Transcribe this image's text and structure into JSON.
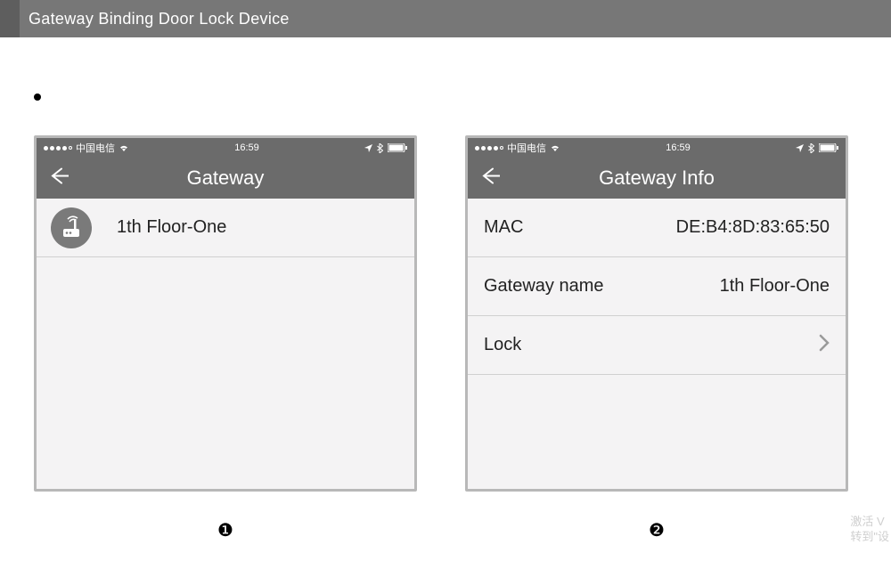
{
  "banner": {
    "title": "Gateway Binding Door Lock Device"
  },
  "status": {
    "carrier": "中国电信",
    "time": "16:59"
  },
  "phone1": {
    "navTitle": "Gateway",
    "item": {
      "label": "1th Floor-One"
    }
  },
  "phone2": {
    "navTitle": "Gateway Info",
    "rows": {
      "macLabel": "MAC",
      "macValue": "DE:B4:8D:83:65:50",
      "gatewayNameLabel": "Gateway name",
      "gatewayNameValue": "1th Floor-One",
      "lockLabel": "Lock"
    }
  },
  "steps": {
    "one": "❶",
    "two": "❷"
  },
  "watermark": {
    "line1": "激活 V",
    "line2": "转到\"设"
  }
}
